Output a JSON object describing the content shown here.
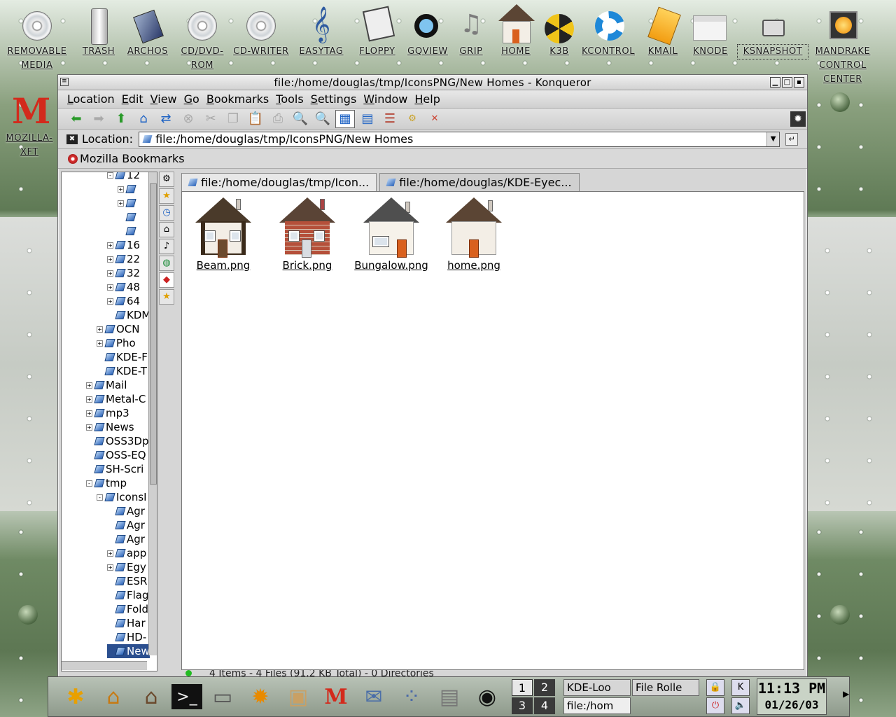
{
  "desktop": {
    "icons": [
      {
        "name": "removable-media",
        "label": "REMOVABLE MEDIA"
      },
      {
        "name": "trash",
        "label": "TRASH"
      },
      {
        "name": "archos",
        "label": "ARCHOS"
      },
      {
        "name": "cd-dvd-rom",
        "label": "CD/DVD-ROM"
      },
      {
        "name": "cd-writer",
        "label": "CD-WRITER"
      },
      {
        "name": "easytag",
        "label": "EASYTAG"
      },
      {
        "name": "floppy",
        "label": "FLOPPY"
      },
      {
        "name": "gqview",
        "label": "GQVIEW"
      },
      {
        "name": "grip",
        "label": "GRIP"
      },
      {
        "name": "home",
        "label": "HOME"
      },
      {
        "name": "k3b",
        "label": "K3B"
      },
      {
        "name": "kcontrol",
        "label": "KCONTROL"
      },
      {
        "name": "kmail",
        "label": "KMAIL"
      },
      {
        "name": "knode",
        "label": "KNODE"
      },
      {
        "name": "ksnapshot",
        "label": "KSNAPSHOT"
      },
      {
        "name": "mandrake-control-center",
        "label": "MANDRAKE CONTROL CENTER"
      },
      {
        "name": "mozilla-xft",
        "label": "MOZILLA-XFT"
      }
    ]
  },
  "window": {
    "title": "file:/home/douglas/tmp/IconsPNG/New Homes - Konqueror",
    "menu": [
      "Location",
      "Edit",
      "View",
      "Go",
      "Bookmarks",
      "Tools",
      "Settings",
      "Window",
      "Help"
    ],
    "location_label": "Location:",
    "location_value": "file:/home/douglas/tmp/IconsPNG/New Homes",
    "bookmarks_folder": "Mozilla Bookmarks",
    "tabs": [
      {
        "label": "file:/home/douglas/tmp/Icon...",
        "active": true
      },
      {
        "label": "file:/home/douglas/KDE-Eyec...",
        "active": false
      }
    ],
    "files": [
      {
        "name": "Beam.png",
        "style": "tudor"
      },
      {
        "name": "Brick.png",
        "style": "brick"
      },
      {
        "name": "Bungalow.png",
        "style": "bungalow"
      },
      {
        "name": "home.png",
        "style": "plain"
      }
    ],
    "status": "4 Items - 4 Files (91.2 KB Total) - 0 Directories",
    "tree": [
      {
        "label": "12",
        "indent": 3,
        "exp": "-"
      },
      {
        "label": "",
        "indent": 4,
        "exp": "+"
      },
      {
        "label": "",
        "indent": 4,
        "exp": "+"
      },
      {
        "label": "",
        "indent": 4,
        "exp": ""
      },
      {
        "label": "",
        "indent": 4,
        "exp": ""
      },
      {
        "label": "16",
        "indent": 3,
        "exp": "+"
      },
      {
        "label": "22",
        "indent": 3,
        "exp": "+"
      },
      {
        "label": "32",
        "indent": 3,
        "exp": "+"
      },
      {
        "label": "48",
        "indent": 3,
        "exp": "+"
      },
      {
        "label": "64",
        "indent": 3,
        "exp": "+"
      },
      {
        "label": "KDM",
        "indent": 3,
        "exp": ""
      },
      {
        "label": "OCN",
        "indent": 2,
        "exp": "+"
      },
      {
        "label": "Pho",
        "indent": 2,
        "exp": "+"
      },
      {
        "label": "KDE-F",
        "indent": 2,
        "exp": ""
      },
      {
        "label": "KDE-T",
        "indent": 2,
        "exp": ""
      },
      {
        "label": "Mail",
        "indent": 1,
        "exp": "+"
      },
      {
        "label": "Metal-C",
        "indent": 1,
        "exp": "+"
      },
      {
        "label": "mp3",
        "indent": 1,
        "exp": "+"
      },
      {
        "label": "News",
        "indent": 1,
        "exp": "+"
      },
      {
        "label": "OSS3Dp",
        "indent": 1,
        "exp": ""
      },
      {
        "label": "OSS-EQ",
        "indent": 1,
        "exp": ""
      },
      {
        "label": "SH-Scri",
        "indent": 1,
        "exp": ""
      },
      {
        "label": "tmp",
        "indent": 1,
        "exp": "-"
      },
      {
        "label": "IconsI",
        "indent": 2,
        "exp": "-"
      },
      {
        "label": "Agr",
        "indent": 3,
        "exp": ""
      },
      {
        "label": "Agr",
        "indent": 3,
        "exp": ""
      },
      {
        "label": "Agr",
        "indent": 3,
        "exp": ""
      },
      {
        "label": "app",
        "indent": 3,
        "exp": "+"
      },
      {
        "label": "Egy",
        "indent": 3,
        "exp": "+"
      },
      {
        "label": "ESR",
        "indent": 3,
        "exp": ""
      },
      {
        "label": "Flag",
        "indent": 3,
        "exp": ""
      },
      {
        "label": "Fold",
        "indent": 3,
        "exp": ""
      },
      {
        "label": "Har",
        "indent": 3,
        "exp": ""
      },
      {
        "label": "HD-",
        "indent": 3,
        "exp": ""
      },
      {
        "label": "New",
        "indent": 3,
        "exp": "",
        "selected": true
      }
    ]
  },
  "panel": {
    "desktops": [
      "1",
      "2",
      "3",
      "4"
    ],
    "tasks": [
      "KDE-Loo",
      "File Rolle",
      "file:/hom"
    ],
    "clock_time": "11:13 PM",
    "clock_date": "01/26/03"
  }
}
